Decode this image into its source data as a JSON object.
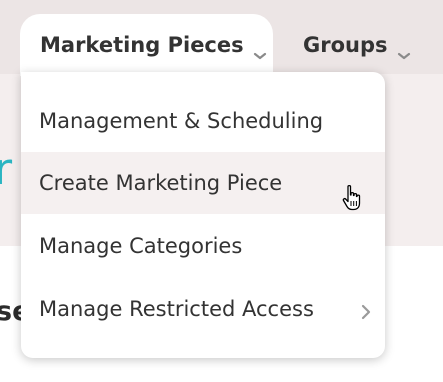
{
  "nav": {
    "tabs": [
      {
        "label": "Marketing Pieces",
        "icon": "chevron-down-icon",
        "active": true
      },
      {
        "label": "Groups",
        "icon": "chevron-down-icon",
        "active": false
      }
    ]
  },
  "dropdown": {
    "items": [
      {
        "label": "Management & Scheduling",
        "has_submenu": false
      },
      {
        "label": "Create Marketing Piece",
        "has_submenu": false,
        "hovered": true
      },
      {
        "label": "Manage Categories",
        "has_submenu": false
      },
      {
        "label": "Manage Restricted Access",
        "has_submenu": true,
        "icon": "chevron-right-icon"
      }
    ]
  },
  "background": {
    "banner_fragment": "r",
    "body_fragment": "se"
  },
  "cursor": {
    "icon": "hand-pointer-icon"
  },
  "colors": {
    "topbar": "#ece5e5",
    "banner": "#f4eeee",
    "accent": "#2bb5c2",
    "text": "#333333",
    "hover": "#f5f0f0"
  }
}
